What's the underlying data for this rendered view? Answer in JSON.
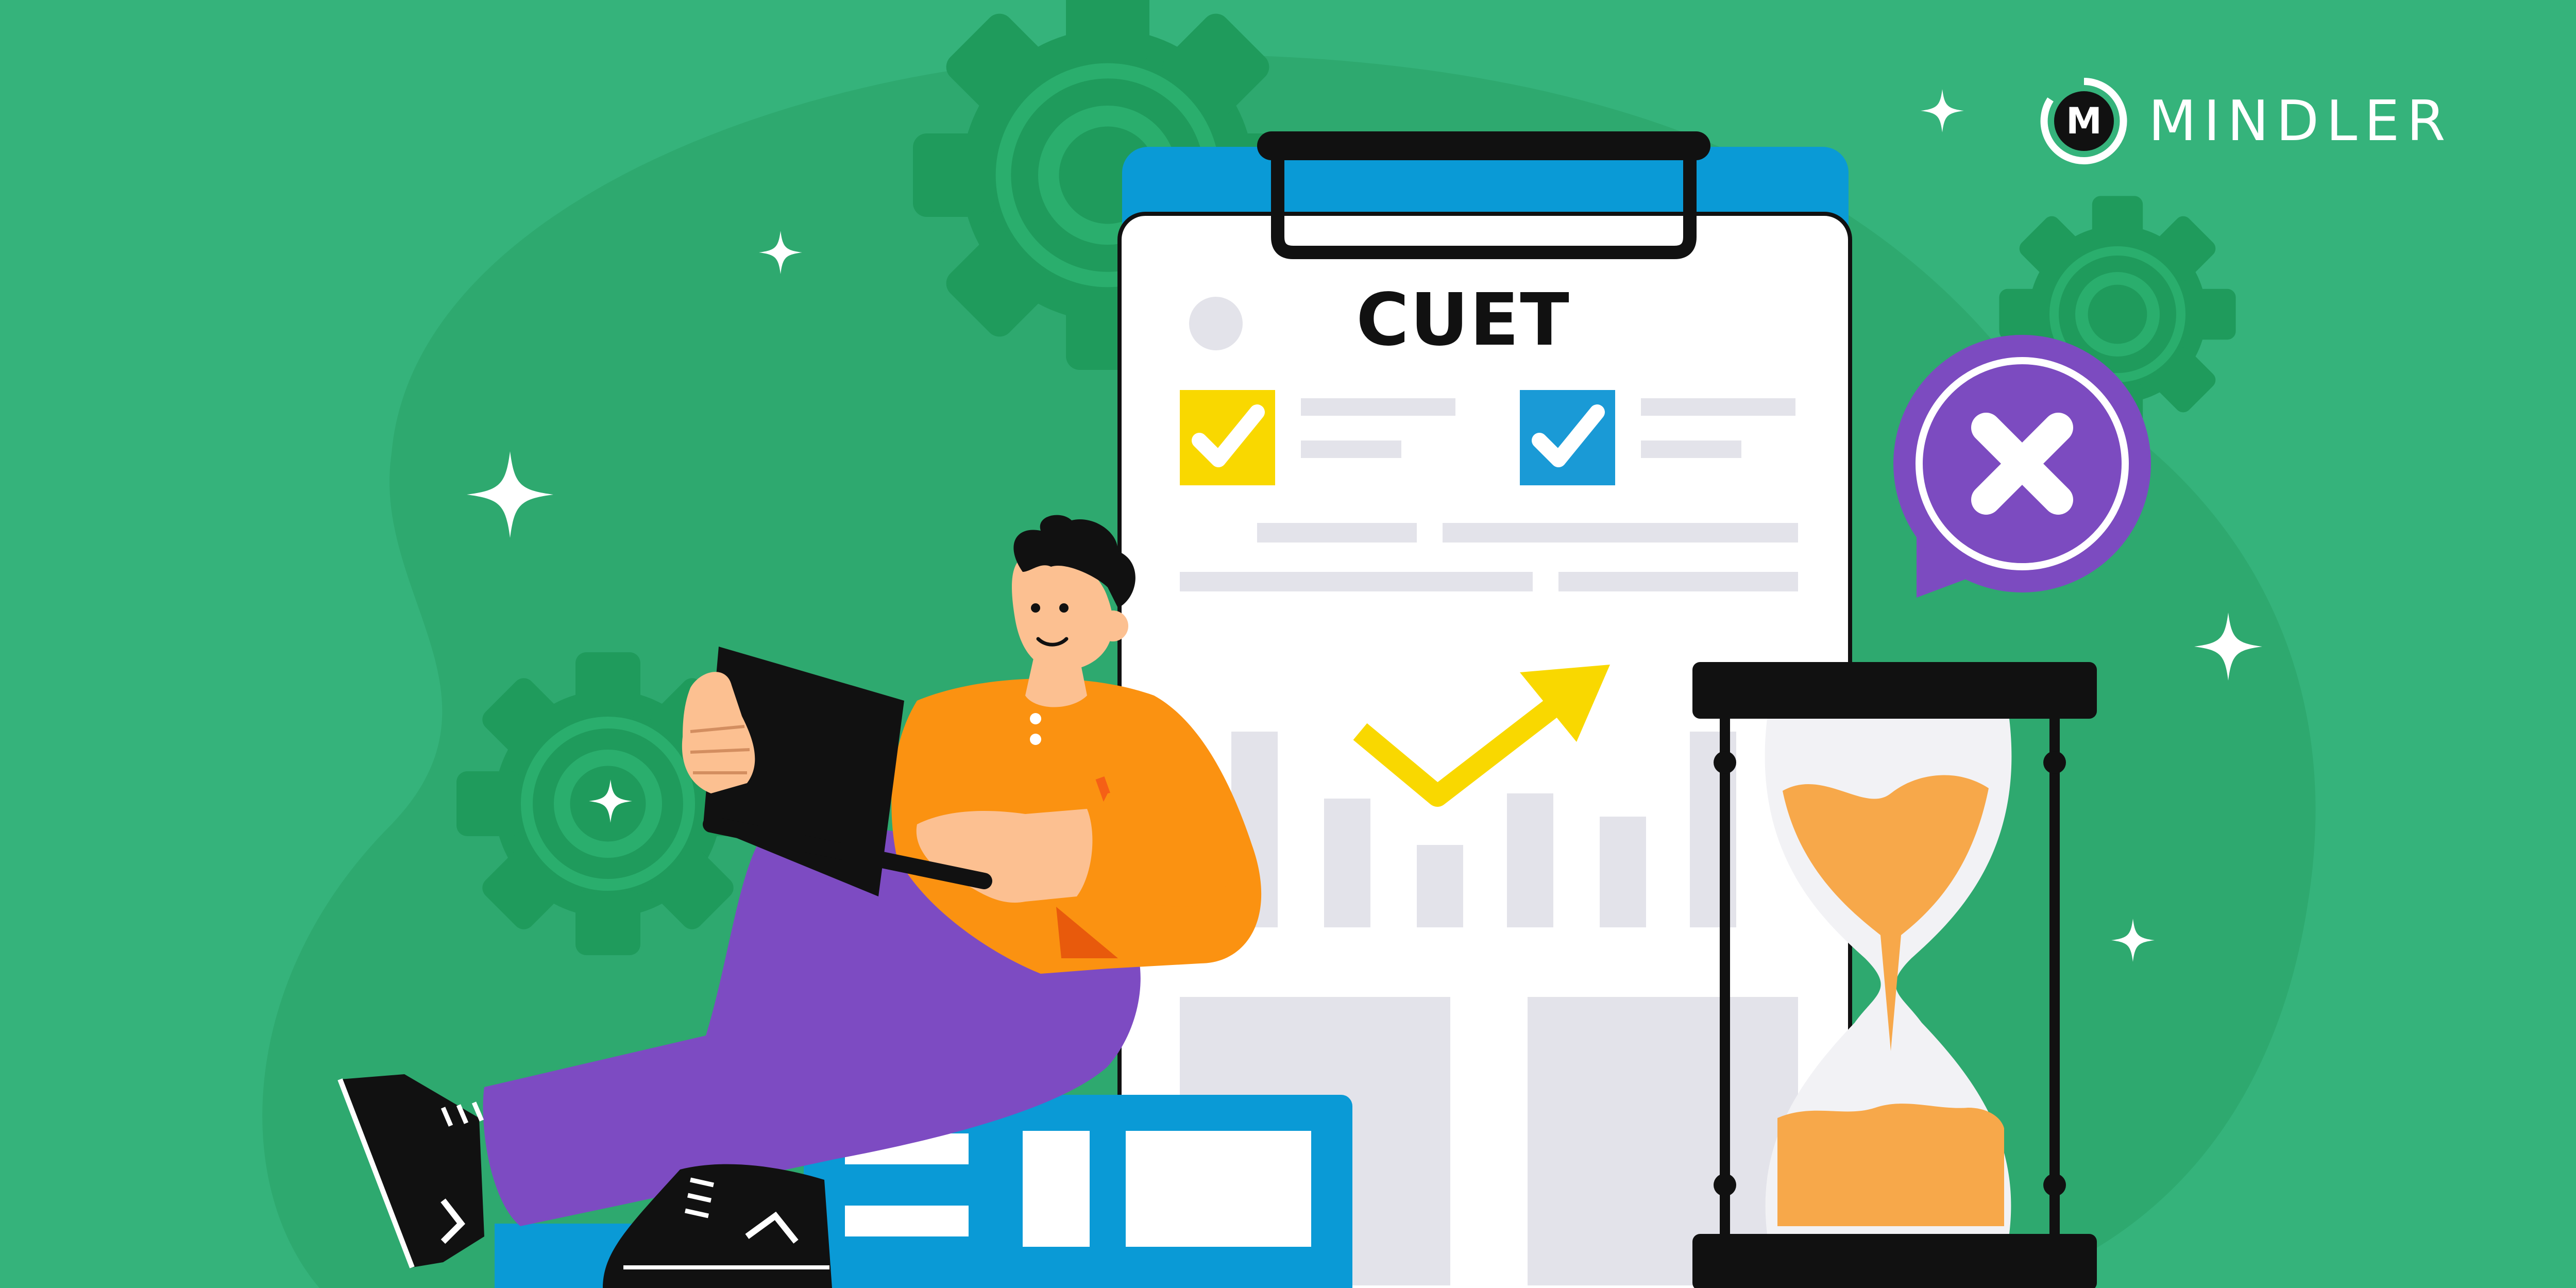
{
  "brand": {
    "name": "MINDLER",
    "logo_letter": "M",
    "logo_icon": "mindler-logo-icon"
  },
  "clipboard": {
    "title": "CUET",
    "checkbox_1": {
      "state": "checked",
      "color": "#f9d800",
      "icon": "check-icon"
    },
    "checkbox_2": {
      "state": "checked",
      "color": "#1a9ad6",
      "icon": "check-icon"
    },
    "trend_icon": "trend-up-arrow-icon"
  },
  "reject_badge": {
    "icon": "close-x-icon",
    "color": "#7c4bc0"
  },
  "hourglass": {
    "icon": "hourglass-icon",
    "sand_color": "#f7a84a"
  },
  "colors": {
    "background": "#35b37b",
    "background_shape": "#2ea96f",
    "gear": "#1f9b5c",
    "clipboard_back": "#0a9ad6",
    "shirt": "#fb9211",
    "pants": "#7d4bc2",
    "skin": "#fcc091",
    "books": "#0a9ad6"
  }
}
